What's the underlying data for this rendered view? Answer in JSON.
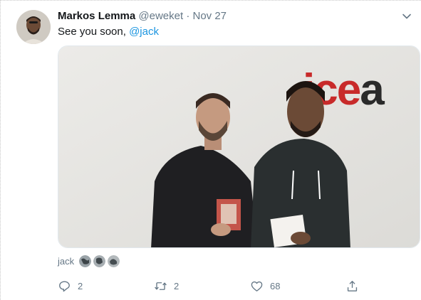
{
  "tweet": {
    "author_name": "Markos Lemma",
    "author_handle": "@eweket",
    "separator": "·",
    "date": "Nov 27",
    "text_prefix": "See you soon, ",
    "mention": "@jack",
    "tagged_label": "jack",
    "photo_wall_text": "icea"
  },
  "actions": {
    "reply_count": "2",
    "retweet_count": "2",
    "like_count": "68"
  },
  "icons": [
    "chevron-down-icon",
    "reply-icon",
    "retweet-icon",
    "like-icon",
    "share-icon"
  ],
  "colors": {
    "text_primary": "#14171a",
    "text_secondary": "#657786",
    "link": "#1b95e0",
    "wall_logo_red": "#c82a2a",
    "wall_logo_dark": "#2a2a2a"
  }
}
